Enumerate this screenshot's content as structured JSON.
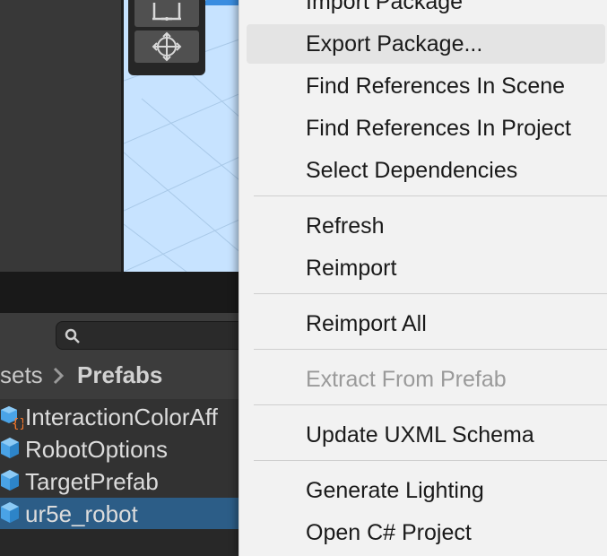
{
  "scene": {
    "tools": [
      {
        "icon": "rect-tool-icon"
      },
      {
        "icon": "transform-tool-icon"
      }
    ]
  },
  "project": {
    "search": {
      "icon": "search-icon",
      "placeholder": ""
    },
    "breadcrumb": {
      "parent": "sets",
      "separator_icon": "chevron-right-icon",
      "current": "Prefabs"
    },
    "assets": [
      {
        "label": "InteractionColorAff",
        "icon": "prefab-variant-icon",
        "selected": false
      },
      {
        "label": "RobotOptions",
        "icon": "prefab-icon",
        "selected": false
      },
      {
        "label": "TargetPrefab",
        "icon": "prefab-icon",
        "selected": false
      },
      {
        "label": "ur5e_robot",
        "icon": "prefab-icon",
        "selected": true
      }
    ],
    "colors": {
      "selection": "#2c5d87",
      "panel": "#323232"
    }
  },
  "context_menu": {
    "items": {
      "import_package": "Import Package",
      "export_package": "Export Package...",
      "find_refs_scene": "Find References In Scene",
      "find_refs_project": "Find References In Project",
      "select_dependencies": "Select Dependencies",
      "refresh": "Refresh",
      "reimport": "Reimport",
      "reimport_all": "Reimport All",
      "extract_from_prefab": "Extract From Prefab",
      "update_uxml_schema": "Update UXML Schema",
      "generate_lighting": "Generate Lighting",
      "open_csharp_project": "Open C# Project"
    },
    "hovered": "Export Package...",
    "disabled": [
      "Extract From Prefab"
    ],
    "colors": {
      "background": "#f2f2f2",
      "hover": "#e4e4e4",
      "text": "#1a1a1a",
      "disabled_text": "#9a9a9a"
    }
  }
}
